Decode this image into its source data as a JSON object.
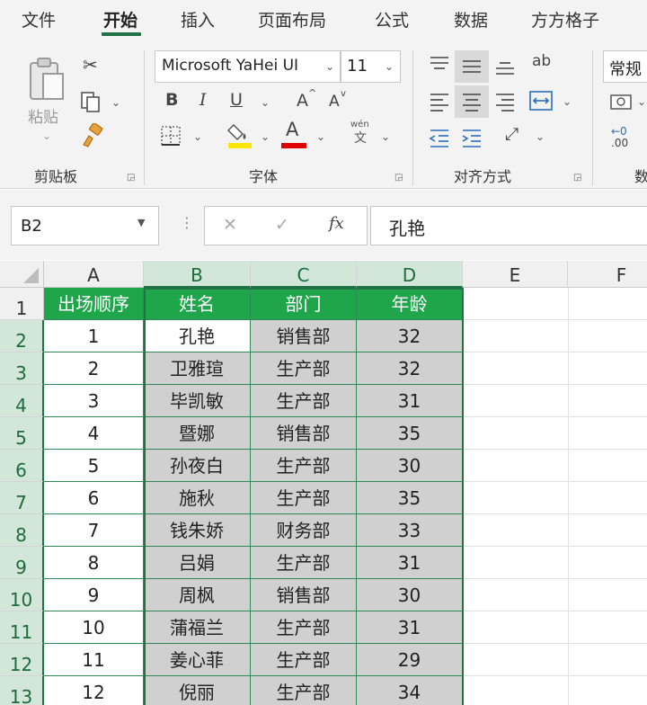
{
  "tabs": [
    "文件",
    "开始",
    "插入",
    "页面布局",
    "公式",
    "数据",
    "方方格子"
  ],
  "ribbon": {
    "clipboard": {
      "paste_label": "粘贴",
      "group_label": "剪贴板"
    },
    "font": {
      "font_name": "Microsoft YaHei UI",
      "font_size": "11",
      "group_label": "字体",
      "phonetic_label": "wén",
      "bold": "B",
      "italic": "I",
      "underline": "U",
      "grow": "A",
      "shrink": "A"
    },
    "alignment": {
      "group_label": "对齐方式"
    },
    "number": {
      "format": "常规",
      "group_label": "数",
      "decimal_label": ".00"
    }
  },
  "formula_bar": {
    "name_box": "B2",
    "formula": "孔艳",
    "fx": "fx"
  },
  "columns": [
    "A",
    "B",
    "C",
    "D",
    "E",
    "F"
  ],
  "rows": [
    "1",
    "2",
    "3",
    "4",
    "5",
    "6",
    "7",
    "8",
    "9",
    "10",
    "11",
    "12",
    "13"
  ],
  "table": {
    "headers": [
      "出场顺序",
      "姓名",
      "部门",
      "年龄"
    ],
    "rows": [
      [
        "1",
        "孔艳",
        "销售部",
        "32"
      ],
      [
        "2",
        "卫雅瑄",
        "生产部",
        "32"
      ],
      [
        "3",
        "毕凯敏",
        "生产部",
        "31"
      ],
      [
        "4",
        "暨娜",
        "销售部",
        "35"
      ],
      [
        "5",
        "孙夜白",
        "生产部",
        "30"
      ],
      [
        "6",
        "施秋",
        "生产部",
        "35"
      ],
      [
        "7",
        "钱朱娇",
        "财务部",
        "33"
      ],
      [
        "8",
        "吕娟",
        "生产部",
        "31"
      ],
      [
        "9",
        "周枫",
        "销售部",
        "30"
      ],
      [
        "10",
        "蒲福兰",
        "生产部",
        "31"
      ],
      [
        "11",
        "姜心菲",
        "生产部",
        "29"
      ],
      [
        "12",
        "倪丽",
        "生产部",
        "34"
      ]
    ]
  },
  "colors": {
    "accent": "#217346",
    "header_fill": "#1fa64b",
    "selection_fill": "#d0d0d0"
  }
}
